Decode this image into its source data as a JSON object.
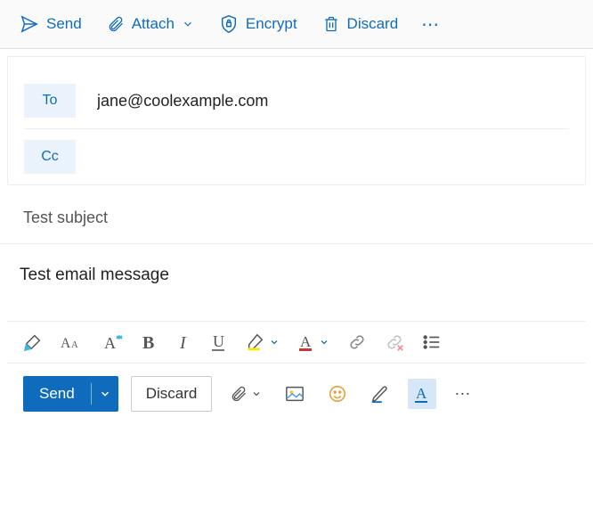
{
  "top_toolbar": {
    "send": "Send",
    "attach": "Attach",
    "encrypt": "Encrypt",
    "discard": "Discard"
  },
  "compose": {
    "to_label": "To",
    "to_value": "jane@coolexample.com",
    "cc_label": "Cc",
    "cc_value": "",
    "subject": "Test subject",
    "body": "Test email message"
  },
  "bottom_toolbar": {
    "send": "Send",
    "discard": "Discard"
  }
}
